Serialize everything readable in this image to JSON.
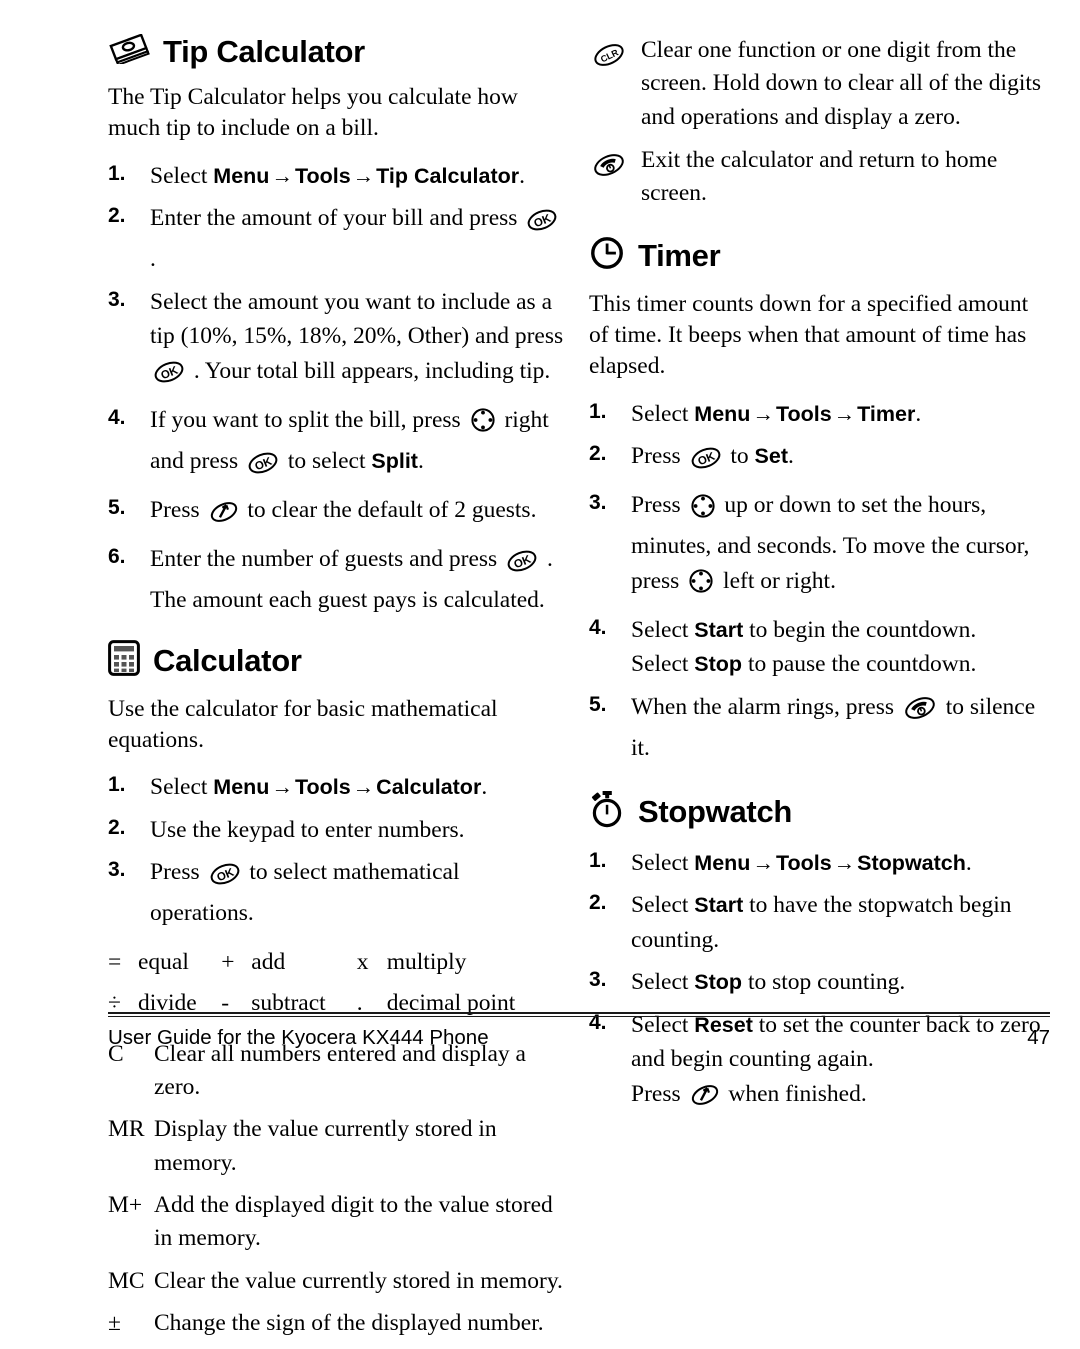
{
  "document": {
    "footer_text": "User Guide for the Kyocera KX444 Phone",
    "page_number": "47"
  },
  "arrow_glyph": "→",
  "left_column": {
    "tip_calculator": {
      "icon": "money-bills-icon",
      "heading": "Tip Calculator",
      "intro": "The Tip Calculator helps you calculate how much tip to include on a bill.",
      "steps": [
        {
          "num": "1.",
          "parts": [
            {
              "t": "text",
              "v": "Select "
            },
            {
              "t": "ui",
              "v": "Menu"
            },
            {
              "t": "arrow"
            },
            {
              "t": "ui",
              "v": "Tools"
            },
            {
              "t": "arrow"
            },
            {
              "t": "ui",
              "v": "Tip Calculator"
            },
            {
              "t": "text",
              "v": "."
            }
          ]
        },
        {
          "num": "2.",
          "parts": [
            {
              "t": "text",
              "v": "Enter the amount of your bill and press "
            },
            {
              "t": "icon",
              "v": "ok-key-icon"
            },
            {
              "t": "text",
              "v": " ."
            }
          ]
        },
        {
          "num": "3.",
          "parts": [
            {
              "t": "text",
              "v": "Select the amount you want to include as a tip (10%, 15%, 18%, 20%, Other) and press "
            },
            {
              "t": "icon",
              "v": "ok-key-icon"
            },
            {
              "t": "text",
              "v": " . Your total bill appears, including tip."
            }
          ]
        },
        {
          "num": "4.",
          "parts": [
            {
              "t": "text",
              "v": "If you want to split the bill, press "
            },
            {
              "t": "icon",
              "v": "navigation-key-icon"
            },
            {
              "t": "text",
              "v": " right and press "
            },
            {
              "t": "icon",
              "v": "ok-key-icon"
            },
            {
              "t": "text",
              "v": " to select "
            },
            {
              "t": "ui",
              "v": "Split"
            },
            {
              "t": "text",
              "v": "."
            }
          ]
        },
        {
          "num": "5.",
          "parts": [
            {
              "t": "text",
              "v": "Press "
            },
            {
              "t": "icon",
              "v": "back-clear-key-icon"
            },
            {
              "t": "text",
              "v": " to clear the default of 2 guests."
            }
          ]
        },
        {
          "num": "6.",
          "parts": [
            {
              "t": "text",
              "v": "Enter the number of guests and press "
            },
            {
              "t": "icon",
              "v": "ok-key-icon"
            },
            {
              "t": "text",
              "v": " ."
            }
          ],
          "continuation": "The amount each guest pays is calculated."
        }
      ]
    },
    "calculator": {
      "icon": "calculator-icon",
      "heading": "Calculator",
      "intro": "Use the calculator for basic mathematical equations.",
      "steps": [
        {
          "num": "1.",
          "parts": [
            {
              "t": "text",
              "v": "Select "
            },
            {
              "t": "ui",
              "v": "Menu"
            },
            {
              "t": "arrow"
            },
            {
              "t": "ui",
              "v": "Tools"
            },
            {
              "t": "arrow"
            },
            {
              "t": "ui",
              "v": "Calculator"
            },
            {
              "t": "text",
              "v": "."
            }
          ]
        },
        {
          "num": "2.",
          "parts": [
            {
              "t": "text",
              "v": "Use the keypad to enter numbers."
            }
          ]
        },
        {
          "num": "3.",
          "parts": [
            {
              "t": "text",
              "v": "Press "
            },
            {
              "t": "icon",
              "v": "ok-key-icon"
            },
            {
              "t": "text",
              "v": " to select mathematical operations."
            }
          ]
        }
      ],
      "operator_table": [
        [
          {
            "symbol": "=",
            "word": "equal"
          },
          {
            "symbol": "+",
            "word": "add"
          },
          {
            "symbol": "x",
            "word": "multiply"
          }
        ],
        [
          {
            "symbol": "÷",
            "word": "divide"
          },
          {
            "symbol": "-",
            "word": "subtract"
          },
          {
            "symbol": ".",
            "word": "decimal point"
          }
        ]
      ],
      "memory_rows": [
        {
          "label": "C",
          "text": "Clear all numbers entered and display a zero."
        },
        {
          "label": "MR",
          "text": "Display the value currently stored in memory."
        },
        {
          "label": "M+",
          "text": "Add the displayed digit to the value stored in memory."
        },
        {
          "label": "MC",
          "text": "Clear the value currently stored in memory."
        },
        {
          "label": "±",
          "text": "Change the sign of the displayed number."
        }
      ]
    }
  },
  "right_column": {
    "calculator_keys": [
      {
        "icon": "clr-key-icon",
        "text": "Clear one function or one digit from the screen. Hold down to clear all of the digits and operations and display a zero."
      },
      {
        "icon": "end-key-icon",
        "text": "Exit the calculator and return to home screen."
      }
    ],
    "timer": {
      "icon": "clock-icon",
      "heading": "Timer",
      "intro": "This timer counts down for a specified amount of time. It beeps when that amount of time has elapsed.",
      "steps": [
        {
          "num": "1.",
          "parts": [
            {
              "t": "text",
              "v": "Select "
            },
            {
              "t": "ui",
              "v": "Menu"
            },
            {
              "t": "arrow"
            },
            {
              "t": "ui",
              "v": "Tools"
            },
            {
              "t": "arrow"
            },
            {
              "t": "ui",
              "v": "Timer"
            },
            {
              "t": "text",
              "v": "."
            }
          ]
        },
        {
          "num": "2.",
          "parts": [
            {
              "t": "text",
              "v": "Press "
            },
            {
              "t": "icon",
              "v": "ok-key-icon"
            },
            {
              "t": "text",
              "v": " to "
            },
            {
              "t": "ui",
              "v": "Set"
            },
            {
              "t": "text",
              "v": "."
            }
          ]
        },
        {
          "num": "3.",
          "parts": [
            {
              "t": "text",
              "v": "Press "
            },
            {
              "t": "icon",
              "v": "navigation-key-icon"
            },
            {
              "t": "text",
              "v": " up or down to set the hours, minutes, and seconds. To move the cursor, press "
            },
            {
              "t": "icon",
              "v": "navigation-key-icon"
            },
            {
              "t": "text",
              "v": " left or right."
            }
          ]
        },
        {
          "num": "4.",
          "parts": [
            {
              "t": "text",
              "v": "Select "
            },
            {
              "t": "ui",
              "v": "Start"
            },
            {
              "t": "text",
              "v": " to begin the countdown."
            }
          ],
          "continuation_parts": [
            {
              "t": "text",
              "v": "Select "
            },
            {
              "t": "ui",
              "v": "Stop"
            },
            {
              "t": "text",
              "v": " to pause the countdown."
            }
          ]
        },
        {
          "num": "5.",
          "parts": [
            {
              "t": "text",
              "v": "When the alarm rings, press "
            },
            {
              "t": "icon",
              "v": "end-key-icon"
            },
            {
              "t": "text",
              "v": " to silence it."
            }
          ]
        }
      ]
    },
    "stopwatch": {
      "icon": "stopwatch-icon",
      "heading": "Stopwatch",
      "steps": [
        {
          "num": "1.",
          "parts": [
            {
              "t": "text",
              "v": "Select "
            },
            {
              "t": "ui",
              "v": "Menu"
            },
            {
              "t": "arrow"
            },
            {
              "t": "ui",
              "v": "Tools"
            },
            {
              "t": "arrow"
            },
            {
              "t": "ui",
              "v": "Stopwatch"
            },
            {
              "t": "text",
              "v": "."
            }
          ]
        },
        {
          "num": "2.",
          "parts": [
            {
              "t": "text",
              "v": "Select "
            },
            {
              "t": "ui",
              "v": "Start"
            },
            {
              "t": "text",
              "v": " to have the stopwatch begin counting."
            }
          ]
        },
        {
          "num": "3.",
          "parts": [
            {
              "t": "text",
              "v": "Select "
            },
            {
              "t": "ui",
              "v": "Stop"
            },
            {
              "t": "text",
              "v": " to stop counting."
            }
          ]
        },
        {
          "num": "4.",
          "parts": [
            {
              "t": "text",
              "v": "Select "
            },
            {
              "t": "ui",
              "v": "Reset"
            },
            {
              "t": "text",
              "v": " to set the counter back to zero and begin counting again."
            }
          ],
          "continuation_parts": [
            {
              "t": "text",
              "v": "Press "
            },
            {
              "t": "icon",
              "v": "back-clear-key-icon"
            },
            {
              "t": "text",
              "v": " when finished."
            }
          ]
        }
      ]
    }
  }
}
